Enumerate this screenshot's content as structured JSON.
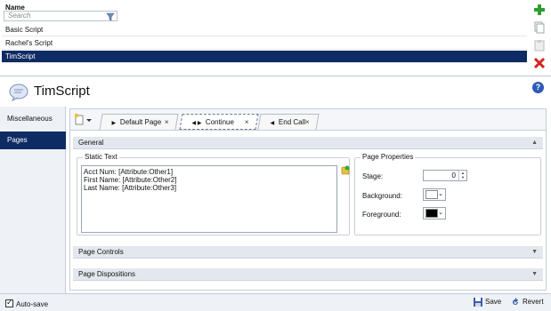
{
  "list": {
    "header": "Name",
    "search_placeholder": "Search",
    "rows": [
      "Basic Script",
      "Rachel's Script",
      "TimScript"
    ],
    "selected_index": 2
  },
  "title": "TimScript",
  "nav": {
    "items": [
      "Miscellaneous",
      "Pages"
    ],
    "active": "Pages"
  },
  "tabs": [
    {
      "label": "Default Page"
    },
    {
      "label": "Continue"
    },
    {
      "label": "End Call"
    }
  ],
  "sections": {
    "general": "General",
    "page_controls": "Page Controls",
    "page_dispositions": "Page Dispositions"
  },
  "static_text": {
    "legend": "Static Text",
    "lines": [
      "Acct Num: [Attribute:Other1]",
      "First Name: [Attribute:Other2]",
      "Last Name: [Attribute:Other3]"
    ]
  },
  "page_properties": {
    "legend": "Page Properties",
    "stage_label": "Stage:",
    "stage_value": "0",
    "background_label": "Background:",
    "foreground_label": "Foreground:",
    "background_color": "#ffffff",
    "foreground_color": "#000000"
  },
  "bottom": {
    "autosave": "Auto-save",
    "save": "Save",
    "revert": "Revert"
  },
  "colors": {
    "selection": "#0f2b63",
    "add": "#2e9e2e",
    "delete": "#d62020"
  }
}
